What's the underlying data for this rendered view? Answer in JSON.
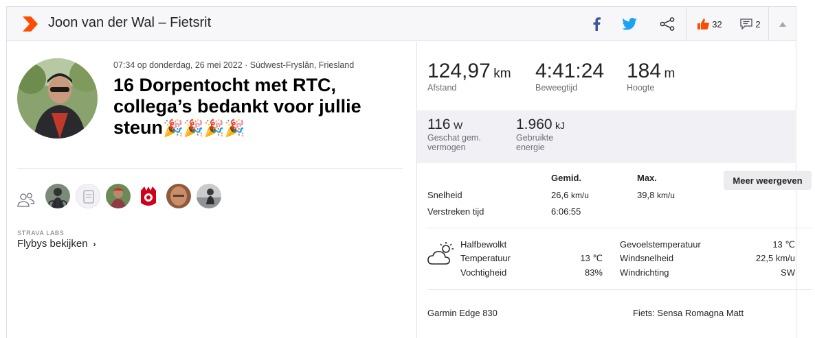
{
  "header": {
    "title": "Joon van der Wal – Fietsrit",
    "kudos_count": "32",
    "comments_count": "2"
  },
  "activity": {
    "meta": "07:34 op donderdag, 26 mei 2022 · Súdwest-Fryslân, Friesland",
    "title": "16 Dorpentocht met RTC, collega’s bedankt voor jullie steun",
    "title_emoji": "🎉🎉🎉🎉"
  },
  "labs": {
    "caption": "STRAVA LABS",
    "link": "Flybys bekijken"
  },
  "primary_stats": [
    {
      "value": "124,97",
      "unit": "km",
      "label": "Afstand"
    },
    {
      "value": "4:41:24",
      "unit": "",
      "label": "Beweegtijd"
    },
    {
      "value": "184",
      "unit": "m",
      "label": "Hoogte"
    }
  ],
  "secondary_stats": [
    {
      "value": "116",
      "unit": "W",
      "label_line1": "Geschat gem.",
      "label_line2": "vermogen"
    },
    {
      "value": "1.960",
      "unit": "kJ",
      "label_line1": "Gebruikte",
      "label_line2": "energie"
    }
  ],
  "stats_table": {
    "col_avg": "Gemid.",
    "col_max": "Max.",
    "more_button": "Meer weergeven",
    "rows": [
      {
        "label": "Snelheid",
        "avg": "26,6",
        "avg_unit": "km/u",
        "max": "39,8",
        "max_unit": "km/u"
      },
      {
        "label": "Verstreken tijd",
        "avg": "6:06:55",
        "avg_unit": "",
        "max": "",
        "max_unit": ""
      }
    ]
  },
  "weather": {
    "condition": "Halfbewolkt",
    "temperature_label": "Temperatuur",
    "temperature_value": "13 ℃",
    "humidity_label": "Vochtigheid",
    "humidity_value": "83%",
    "feels_label": "Gevoelstemperatuur",
    "feels_value": "13 ℃",
    "wind_speed_label": "Windsnelheid",
    "wind_speed_value": "22,5 km/u",
    "wind_dir_label": "Windrichting",
    "wind_dir_value": "SW"
  },
  "gear": {
    "device": "Garmin Edge 830",
    "bike": "Fiets: Sensa Romagna Matt"
  },
  "colors": {
    "brand_orange": "#fc4c02",
    "facebook_blue": "#3b5998",
    "twitter_blue": "#1da1f2"
  }
}
